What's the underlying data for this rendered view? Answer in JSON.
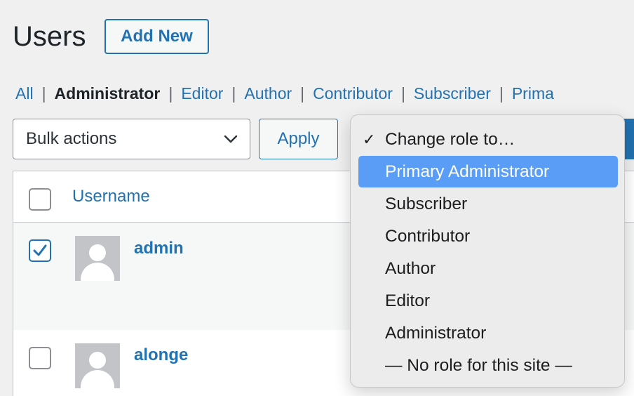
{
  "header": {
    "title": "Users",
    "add_new_label": "Add New"
  },
  "filters": [
    {
      "label": "All",
      "current": false
    },
    {
      "label": "Administrator",
      "current": true
    },
    {
      "label": "Editor",
      "current": false
    },
    {
      "label": "Author",
      "current": false
    },
    {
      "label": "Contributor",
      "current": false
    },
    {
      "label": "Subscriber",
      "current": false
    },
    {
      "label": "Prima",
      "current": false
    }
  ],
  "bulk_actions": {
    "selected": "Bulk actions",
    "apply_label": "Apply"
  },
  "table": {
    "column_username": "Username",
    "rows": [
      {
        "username": "admin",
        "checked": true
      },
      {
        "username": "alonge",
        "checked": false
      }
    ]
  },
  "role_dropdown": {
    "items": [
      {
        "label": "Change role to…",
        "selected": true,
        "highlighted": false
      },
      {
        "label": "Primary Administrator",
        "selected": false,
        "highlighted": true
      },
      {
        "label": "Subscriber",
        "selected": false,
        "highlighted": false
      },
      {
        "label": "Contributor",
        "selected": false,
        "highlighted": false
      },
      {
        "label": "Author",
        "selected": false,
        "highlighted": false
      },
      {
        "label": "Editor",
        "selected": false,
        "highlighted": false
      },
      {
        "label": "Administrator",
        "selected": false,
        "highlighted": false
      },
      {
        "label": "— No role for this site —",
        "selected": false,
        "highlighted": false
      }
    ],
    "check_glyph": "✓"
  },
  "colors": {
    "accent": "#2271b1",
    "highlight": "#5a9df6",
    "background": "#f0f0f1"
  }
}
